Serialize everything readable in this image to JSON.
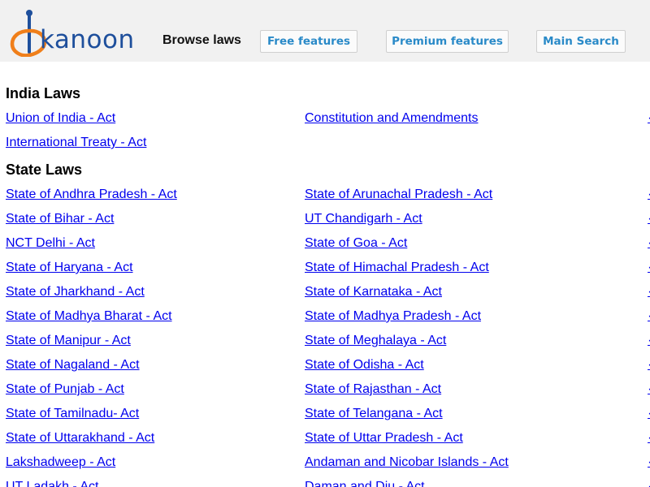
{
  "header": {
    "logo_text": "kanoon",
    "browse_laws": "Browse laws",
    "free_features": "Free features",
    "premium_features": "Premium features",
    "main_search": "Main Search"
  },
  "india_laws": {
    "title": "India Laws",
    "links": [
      "Union of India - Act",
      "Constitution and Amendments",
      "International Treaty - Act"
    ]
  },
  "state_laws": {
    "title": "State Laws",
    "links": [
      "State of Andhra Pradesh - Act",
      "State of Arunachal Pradesh - Act",
      "State of Bihar - Act",
      "UT Chandigarh - Act",
      "NCT Delhi - Act",
      "State of Goa - Act",
      "State of Haryana - Act",
      "State of Himachal Pradesh - Act",
      "State of Jharkhand - Act",
      "State of Karnataka - Act",
      "State of Madhya Bharat - Act",
      "State of Madhya Pradesh - Act",
      "State of Manipur - Act",
      "State of Meghalaya - Act",
      "State of Nagaland - Act",
      "State of Odisha - Act",
      "State of Punjab - Act",
      "State of Rajasthan - Act",
      "State of Tamilnadu- Act",
      "State of Telangana - Act",
      "State of Uttarakhand - Act",
      "State of Uttar Pradesh - Act",
      "Lakshadweep - Act",
      "Andaman and Nicobar Islands - Act",
      "UT Ladakh - Act",
      "Daman and Diu - Act"
    ]
  },
  "colors": {
    "link": "#0000ee",
    "header_bg": "#f1f1f1",
    "button_text": "#2a8ac8",
    "logo_blue": "#1e4f9c",
    "logo_orange": "#f07f1a"
  }
}
